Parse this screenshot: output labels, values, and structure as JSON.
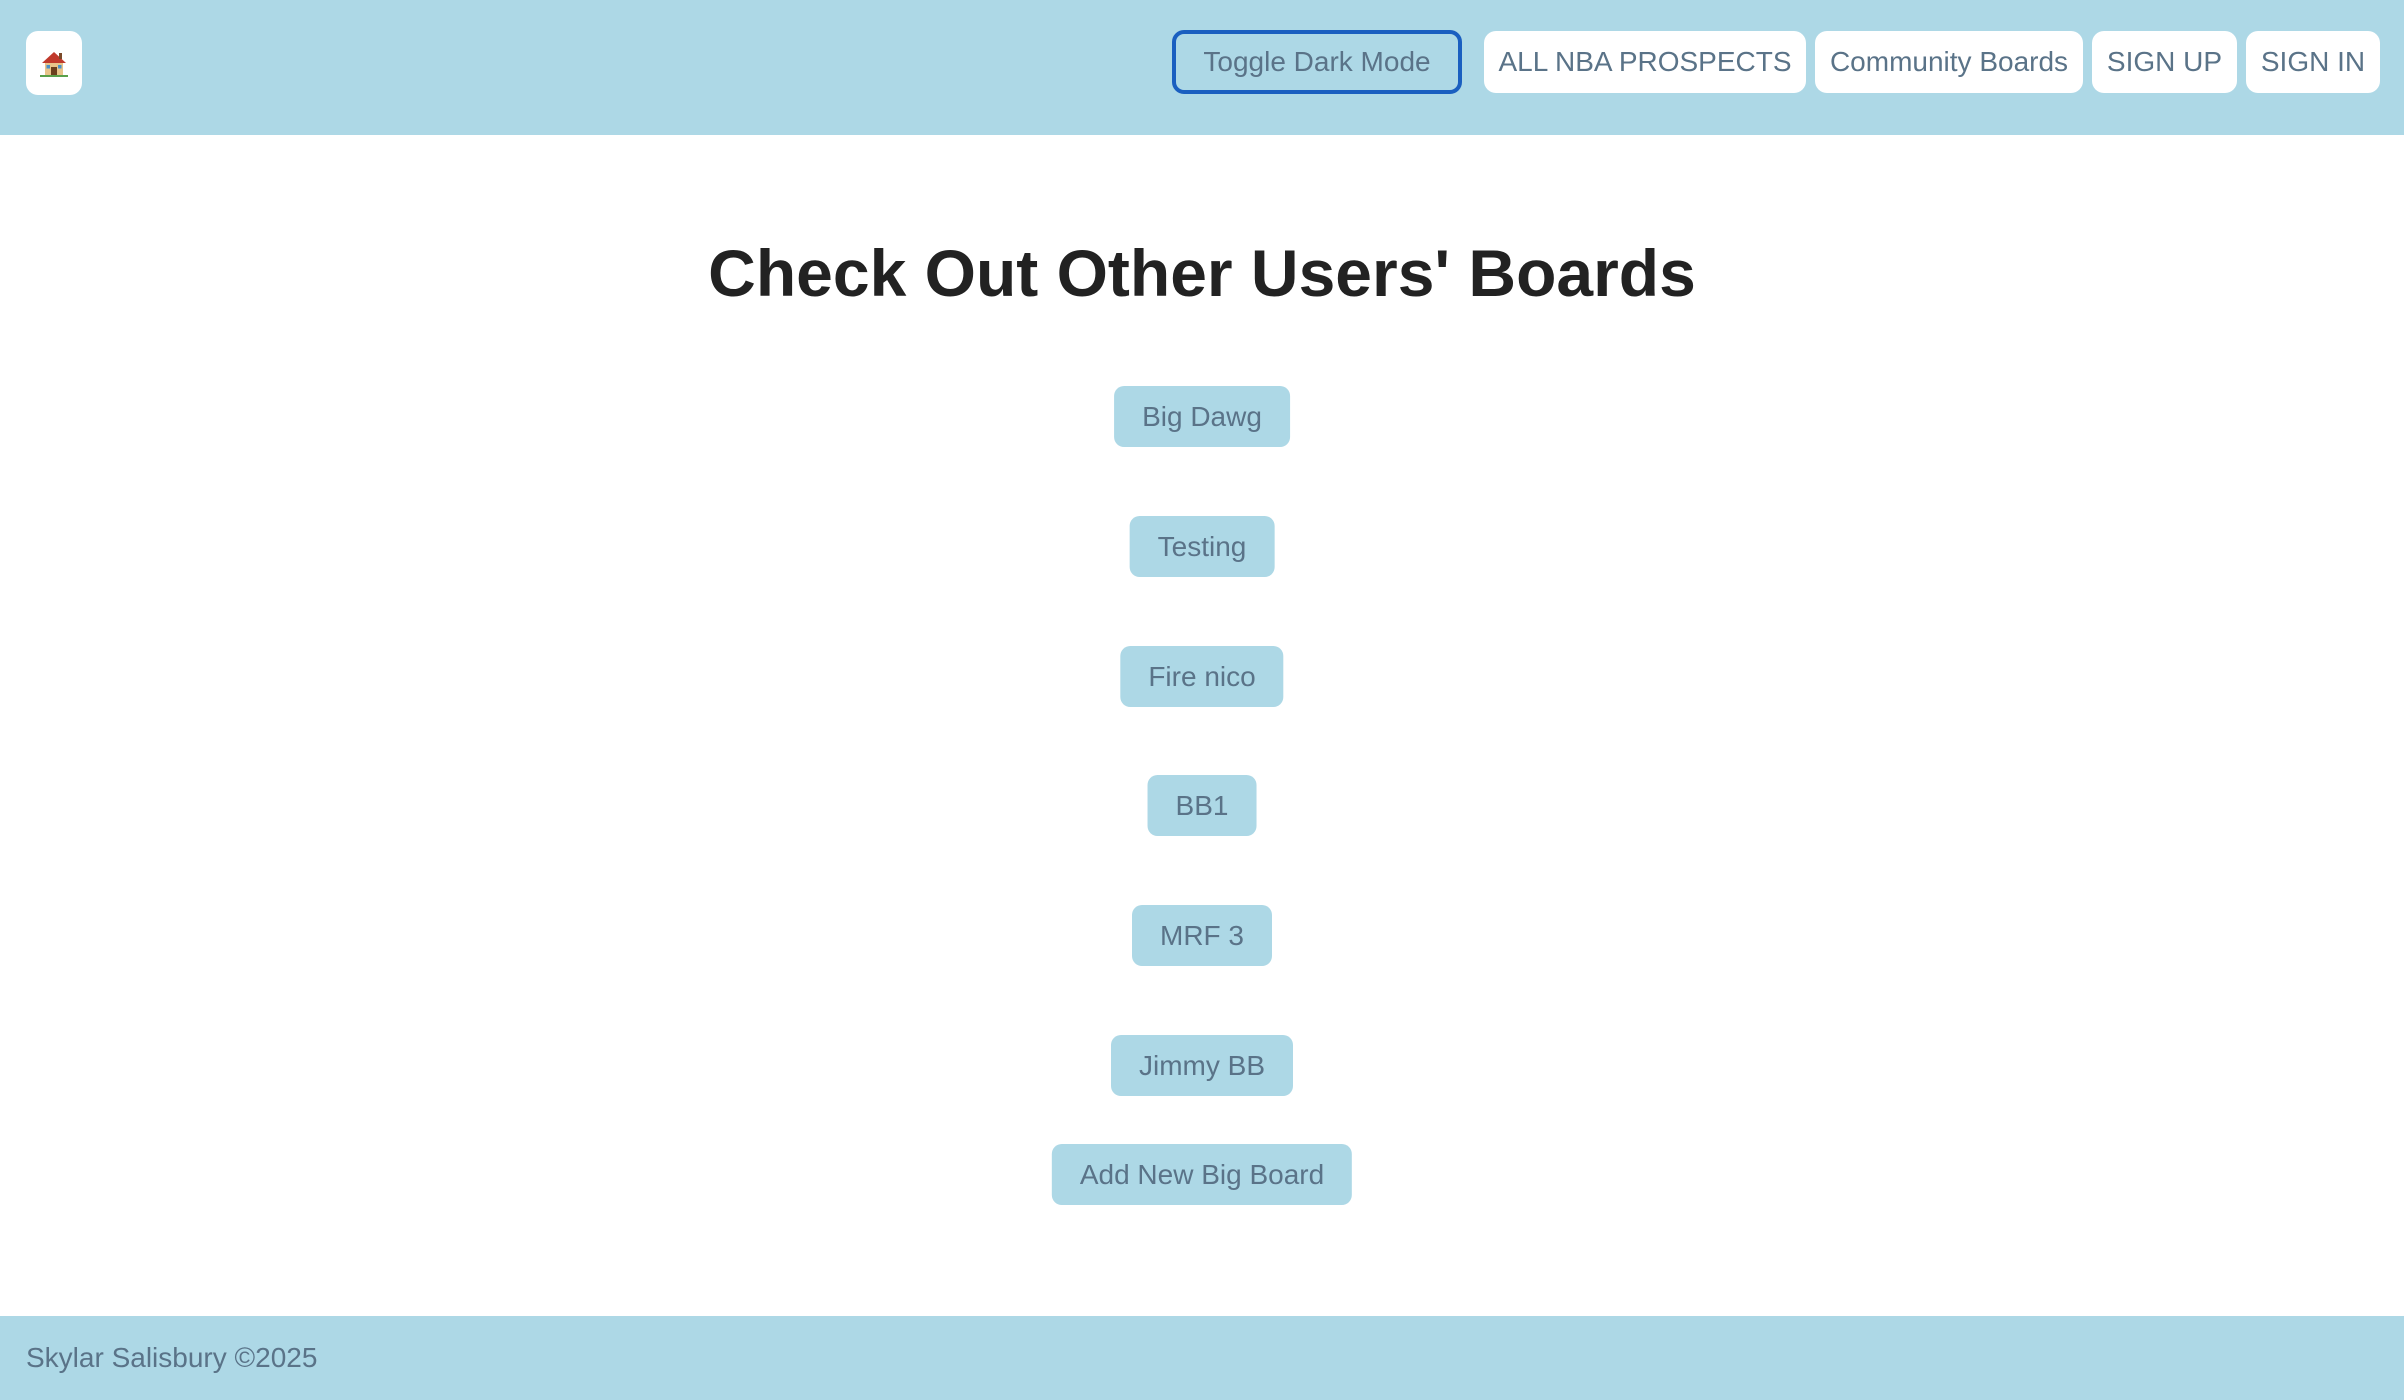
{
  "header": {
    "home_icon": "house-icon",
    "toggle_dark_mode_label": "Toggle Dark Mode",
    "nav": {
      "prospects": "ALL NBA PROSPECTS",
      "community": "Community Boards",
      "signup": "SIGN UP",
      "signin": "SIGN IN"
    }
  },
  "main": {
    "title": "Check Out Other Users' Boards",
    "boards": [
      "Big Dawg",
      "Testing",
      "Fire nico",
      "BB1",
      "MRF 3",
      "Jimmy BB"
    ],
    "add_board_label": "Add New Big Board"
  },
  "footer": {
    "text": "Skylar Salisbury ©2025"
  },
  "colors": {
    "accent": "#add8e6",
    "text_muted": "#5a7388",
    "focus_ring": "#1a5fc0",
    "heading": "#222222"
  }
}
